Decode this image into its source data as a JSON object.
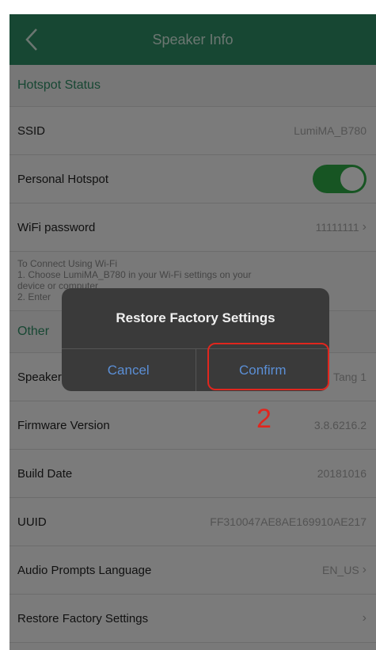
{
  "header": {
    "title": "Speaker Info"
  },
  "hotspot_section": {
    "title": "Hotspot Status"
  },
  "ssid": {
    "label": "SSID",
    "value": "LumiMA_B780"
  },
  "personal_hotspot": {
    "label": "Personal Hotspot",
    "enabled": true
  },
  "wifi_password": {
    "label": "WiFi password",
    "value": "11111111"
  },
  "note_lines": [
    "To Connect Using Wi-Fi",
    "1. Choose LumiMA_B780 in your Wi-Fi settings on your",
    "device or computer",
    "2. Enter"
  ],
  "other_section": {
    "title": "Other"
  },
  "speaker_name": {
    "label": "Speaker Name",
    "value": "Tang 1"
  },
  "firmware": {
    "label": "Firmware Version",
    "value": "3.8.6216.2"
  },
  "build_date": {
    "label": "Build Date",
    "value": "20181016"
  },
  "uuid": {
    "label": "UUID",
    "value": "FF310047AE8AE169910AE217"
  },
  "audio_language": {
    "label": "Audio Prompts Language",
    "value": "EN_US"
  },
  "restore": {
    "label": "Restore Factory Settings"
  },
  "dialog": {
    "title": "Restore Factory Settings",
    "cancel": "Cancel",
    "confirm": "Confirm"
  },
  "annotation": {
    "step": "2"
  },
  "colors": {
    "accent": "#2f8f66",
    "toggle_on": "#2faa47",
    "annotation_red": "#e0261e",
    "dialog_button": "#5b8fd6"
  }
}
